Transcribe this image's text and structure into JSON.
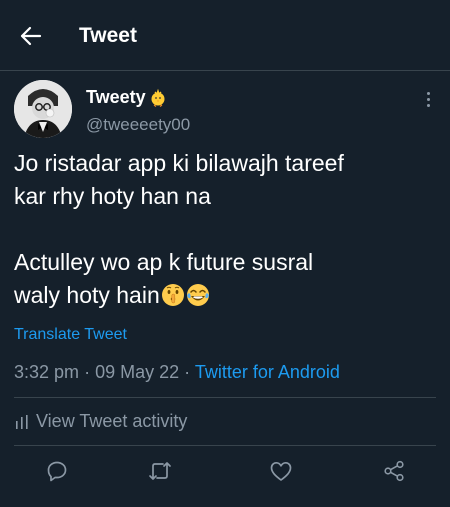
{
  "header": {
    "title": "Tweet"
  },
  "tweet": {
    "display_name": "Tweety",
    "handle": "@tweeeety00",
    "text_lines": [
      "Jo ristadar app ki bilawajh tareef",
      "kar rhy hoty han na",
      "",
      "Actulley wo ap k future susral",
      "waly hoty hain"
    ],
    "emojis": [
      "shushing-face-emoji",
      "tears-of-joy-emoji"
    ],
    "translate_label": "Translate Tweet",
    "time": "3:32 pm",
    "separator": "·",
    "date": "09 May 22",
    "source": "Twitter for Android",
    "activity_label": "View Tweet activity"
  },
  "colors": {
    "background": "#15202b",
    "border": "#38444d",
    "accent": "#1d9bf0",
    "secondary_text": "#8b98a5",
    "primary_text": "#ffffff"
  },
  "actions": [
    {
      "name": "reply",
      "icon": "reply-icon"
    },
    {
      "name": "retweet",
      "icon": "retweet-icon"
    },
    {
      "name": "like",
      "icon": "heart-icon"
    },
    {
      "name": "share",
      "icon": "share-icon"
    }
  ]
}
